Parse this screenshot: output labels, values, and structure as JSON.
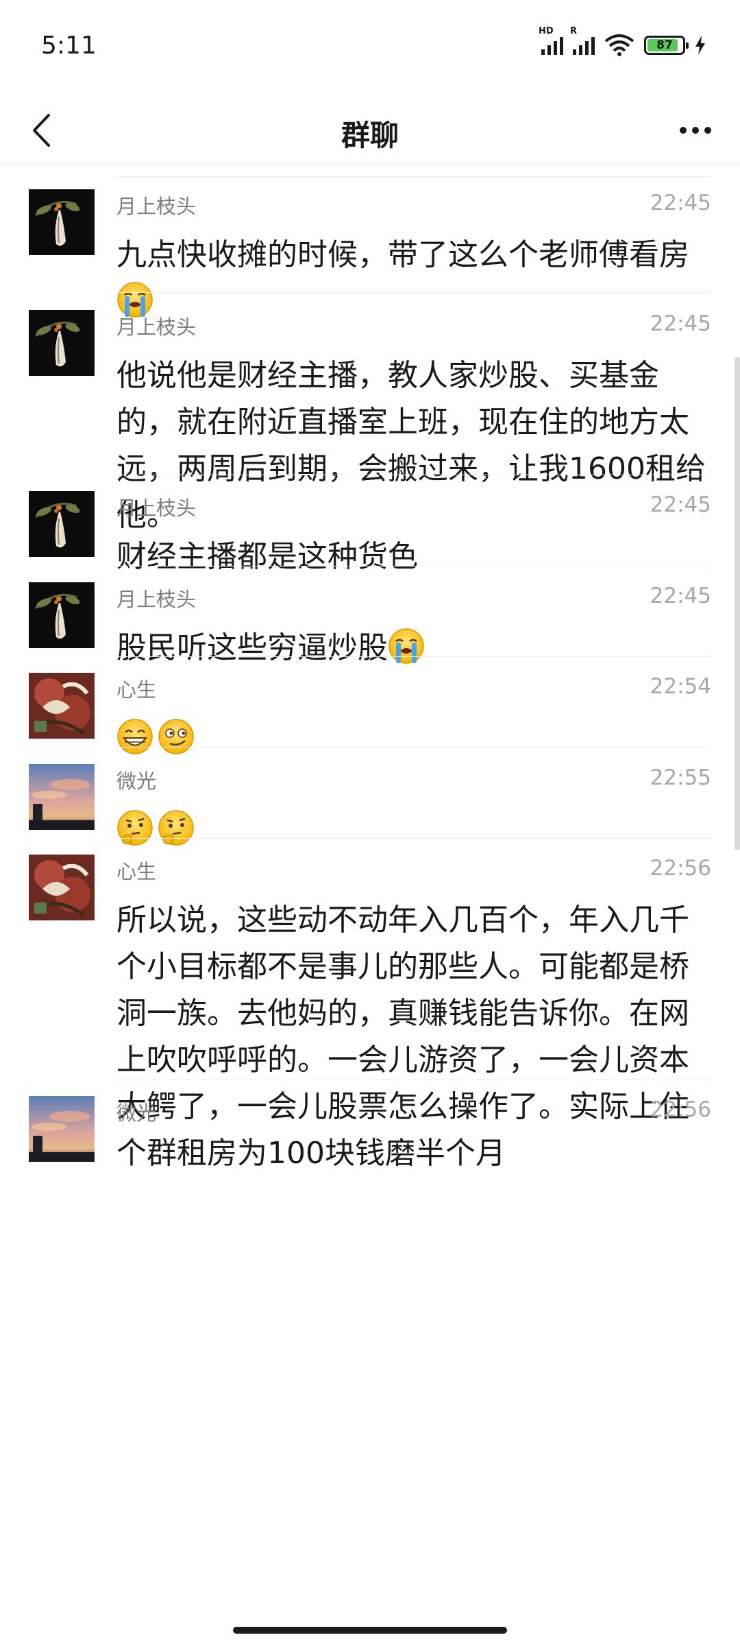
{
  "status_bar": {
    "time": "5:11",
    "signal1_tag": "HD",
    "signal2_tag": "R",
    "battery_level": "87",
    "battery_fraction": 0.87,
    "icons": [
      "signal-icon",
      "signal-icon",
      "wifi-icon",
      "battery-icon",
      "charging-icon"
    ]
  },
  "nav": {
    "title": "群聊",
    "back_icon": "chevron-left-icon",
    "more_icon": "more-dots-icon"
  },
  "messages": [
    {
      "name": "月上枝头",
      "time": "22:45",
      "avatar": "avatar-flower",
      "text": "九点快收摊的时候，带了这么个老师傅看房",
      "emojis": [
        "crying-emoji"
      ]
    },
    {
      "name": "月上枝头",
      "time": "22:45",
      "avatar": "avatar-flower",
      "text": "他说他是财经主播，教人家炒股、买基金的，就在附近直播室上班，现在住的地方太远，两周后到期，会搬过来，让我1600租给他。",
      "emojis": []
    },
    {
      "name": "月上枝头",
      "time": "22:45",
      "avatar": "avatar-flower",
      "text": "财经主播都是这种货色",
      "emojis": []
    },
    {
      "name": "月上枝头",
      "time": "22:45",
      "avatar": "avatar-flower",
      "text": "股民听这些穷逼炒股",
      "emojis": [
        "crying-emoji"
      ]
    },
    {
      "name": "心生",
      "time": "22:54",
      "avatar": "avatar-art",
      "text": "",
      "emojis": [
        "grin-emoji",
        "smirk-emoji"
      ]
    },
    {
      "name": "微光",
      "time": "22:55",
      "avatar": "avatar-sky",
      "text": "",
      "emojis": [
        "thinking-emoji",
        "thinking-emoji"
      ]
    },
    {
      "name": "心生",
      "time": "22:56",
      "avatar": "avatar-art",
      "text": "所以说，这些动不动年入几百个，年入几千个小目标都不是事儿的那些人。可能都是桥洞一族。去他妈的，真赚钱能告诉你。在网上吹吹呼呼的。一会儿游资了，一会儿资本大鳄了，一会儿股票怎么操作了。实际上住个群租房为100块钱磨半个月",
      "emojis": []
    },
    {
      "name": "微光",
      "time": "22:56",
      "avatar": "avatar-sky",
      "text": "",
      "emojis": []
    }
  ]
}
